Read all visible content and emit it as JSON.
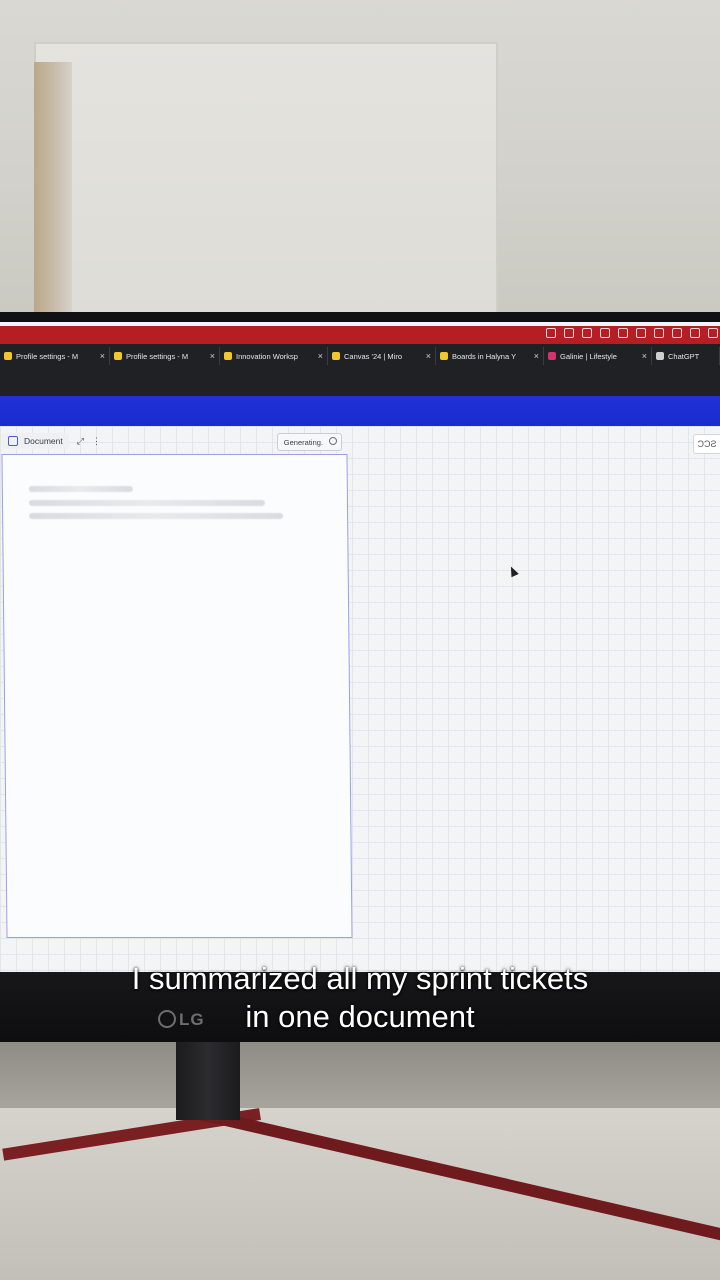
{
  "browser": {
    "tabs": [
      {
        "label": "Profile settings - M",
        "favicon_color": "#f2c72b",
        "closable": true
      },
      {
        "label": "Profile settings - M",
        "favicon_color": "#f2c72b",
        "closable": true
      },
      {
        "label": "Innovation Worksp",
        "favicon_color": "#f2c72b",
        "closable": true
      },
      {
        "label": "Canvas '24 | Miro",
        "favicon_color": "#f2c72b",
        "closable": true
      },
      {
        "label": "Boards in Halyna Y",
        "favicon_color": "#f2c72b",
        "closable": true
      },
      {
        "label": "Galinie | Lifestyle",
        "favicon_color": "#d6336c",
        "closable": true
      },
      {
        "label": "ChatGPT",
        "favicon_color": "#cfcfcf",
        "closable": false
      }
    ],
    "close_glyph": "×"
  },
  "board": {
    "doc_label": "Document",
    "expand_glyph": "⤢",
    "more_glyph": "⋮",
    "status": "Generating.",
    "widget_text": "ƆƆƧ"
  },
  "caption": {
    "line1": "I summarized all my sprint tickets",
    "line2": "in one document"
  },
  "monitor": {
    "brand": "LG"
  },
  "colors": {
    "os_bar": "#b51f24",
    "header_blue": "#1f33d6",
    "doc_border": "#9aa0e6"
  }
}
